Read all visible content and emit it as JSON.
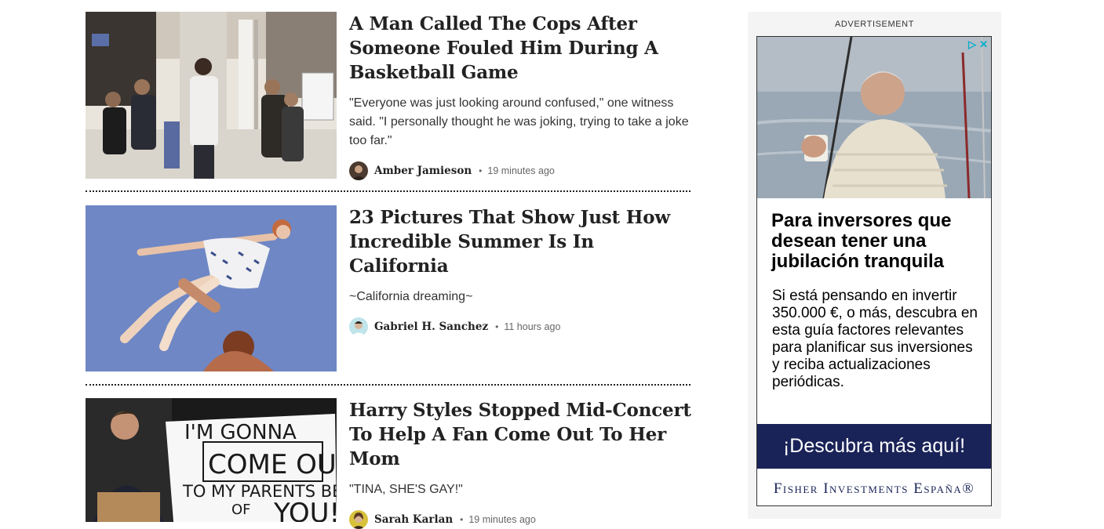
{
  "articles": [
    {
      "headline": "A Man Called The Cops After Someone Fouled Him During A Basketball Game",
      "dek": "\"Everyone was just looking around confused,\" one witness said. \"I personally thought he was joking, trying to take a joke too far.\"",
      "author": "Amber Jamieson",
      "time": "19 minutes ago",
      "separator": "•"
    },
    {
      "headline": "23 Pictures That Show Just How Incredible Summer Is In California",
      "dek": "~California dreaming~",
      "author": "Gabriel H. Sanchez",
      "time": "11 hours ago",
      "separator": "•"
    },
    {
      "headline": "Harry Styles Stopped Mid-Concert To Help A Fan Come Out To Her Mom",
      "dek": "\"TINA, SHE'S GAY!\"",
      "author": "Sarah Karlan",
      "time": "19 minutes ago",
      "separator": "•",
      "sign_text": [
        "I'M GONNA",
        "COME OUT",
        "TO MY PARENTS BEC",
        "OF",
        "YOU!!!"
      ]
    }
  ],
  "ad": {
    "label": "ADVERTISEMENT",
    "headline": "Para inversores que desean tener una jubilación tranquila",
    "body": "Si está pensando en invertir 350.000 €, o más, descubra en esta guía factores relevantes para planificar sus inversiones y reciba actualizaciones periódicas.",
    "cta": "¡Descubra más aquí!",
    "brand": "Fisher Investments España®",
    "adchoices_icon": "▷",
    "close_icon": "✕",
    "colors": {
      "cta_bg": "#1a2358",
      "adchoices": "#00aecd"
    }
  }
}
